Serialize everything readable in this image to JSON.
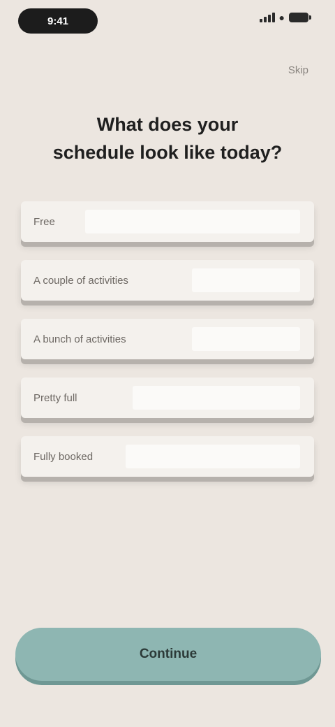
{
  "status_bar": {
    "time": "9:41",
    "icons": [
      "signal-icon",
      "wifi-icon",
      "battery-icon"
    ]
  },
  "top_action": {
    "label": "Skip"
  },
  "question": {
    "line1": "What does your",
    "line2": "schedule look like today?"
  },
  "options": [
    {
      "label": "Free"
    },
    {
      "label": "A couple of activities"
    },
    {
      "label": "A bunch of activities"
    },
    {
      "label": "Pretty full"
    },
    {
      "label": "Fully booked"
    }
  ],
  "cta": {
    "label": "Continue"
  },
  "colors": {
    "background": "#ece6e0",
    "option_card": "#f4f1ed",
    "cta": "#8eb6b2"
  }
}
